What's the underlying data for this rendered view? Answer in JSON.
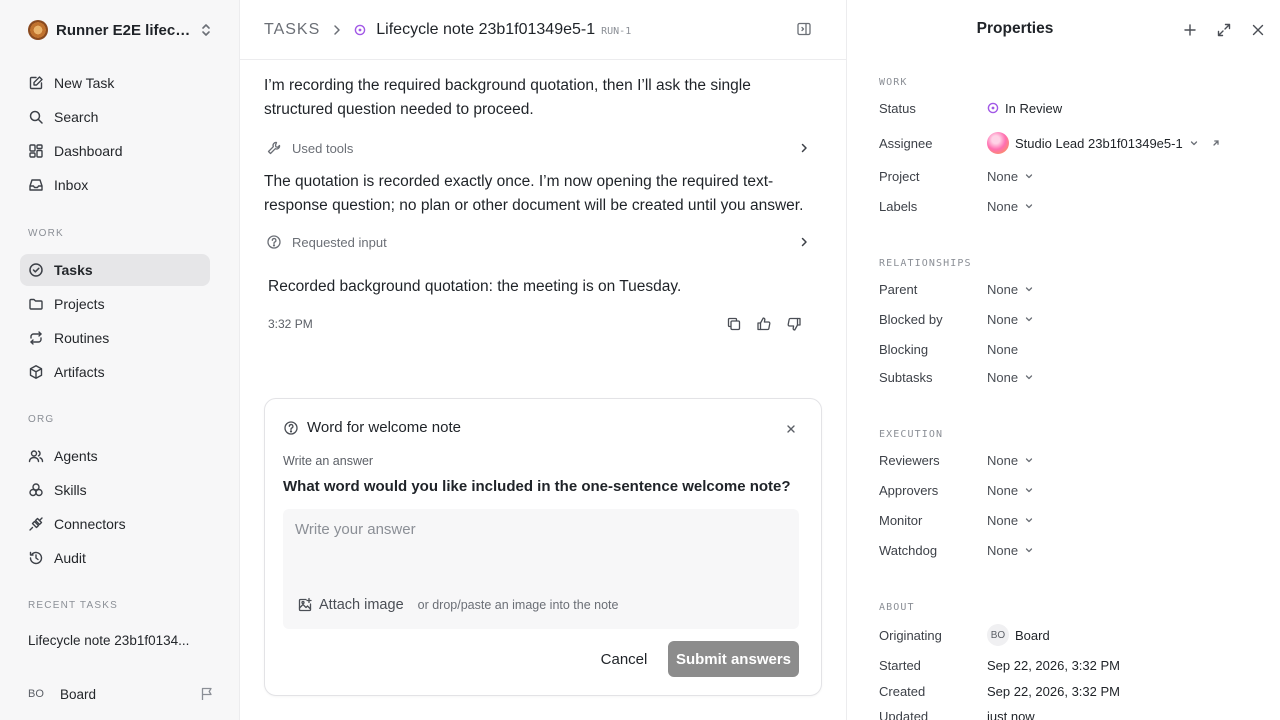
{
  "workspace": {
    "name": "Runner E2E lifecy..."
  },
  "nav": {
    "new_task": "New Task",
    "search": "Search",
    "dashboard": "Dashboard",
    "inbox": "Inbox"
  },
  "sections": {
    "work": "WORK",
    "org": "ORG",
    "recent": "RECENT TASKS"
  },
  "work_nav": {
    "tasks": "Tasks",
    "projects": "Projects",
    "routines": "Routines",
    "artifacts": "Artifacts"
  },
  "org_nav": {
    "agents": "Agents",
    "skills": "Skills",
    "connectors": "Connectors",
    "audit": "Audit"
  },
  "recent_tasks": [
    "Lifecycle note 23b1f0134..."
  ],
  "user": {
    "initials": "BO",
    "name": "Board"
  },
  "header": {
    "root": "TASKS",
    "title": "Lifecycle note 23b1f01349e5-1",
    "run_tag": "RUN-1"
  },
  "messages": {
    "para1": "I’m recording the required background quotation, then I’ll ask the single structured question needed to proceed.",
    "used_tools": "Used tools",
    "para2": "The quotation is recorded exactly once. I’m now opening the required text-response question; no plan or other document will be created until you answer.",
    "requested_input": "Requested input",
    "answer": "Recorded background quotation: the meeting is on Tuesday.",
    "time": "3:32 PM"
  },
  "question_card": {
    "title": "Word for welcome note",
    "label": "Write an answer",
    "question": "What word would you like included in the one-sentence welcome note?",
    "placeholder": "Write your answer",
    "attach_label": "Attach image",
    "attach_hint": "or drop/paste an image into the note",
    "cancel_label": "Cancel",
    "submit_label": "Submit answers"
  },
  "properties": {
    "title": "Properties",
    "sections": {
      "work": "WORK",
      "relationships": "RELATIONSHIPS",
      "execution": "EXECUTION",
      "about": "ABOUT"
    },
    "status": {
      "label": "Status",
      "value": "In Review"
    },
    "assignee": {
      "label": "Assignee",
      "value": "Studio Lead 23b1f01349e5-1"
    },
    "project": {
      "label": "Project",
      "value": "None"
    },
    "labels": {
      "label": "Labels",
      "value": "None"
    },
    "parent": {
      "label": "Parent",
      "value": "None"
    },
    "blocked_by": {
      "label": "Blocked by",
      "value": "None"
    },
    "blocking": {
      "label": "Blocking",
      "value": "None"
    },
    "subtasks": {
      "label": "Subtasks",
      "value": "None"
    },
    "reviewers": {
      "label": "Reviewers",
      "value": "None"
    },
    "approvers": {
      "label": "Approvers",
      "value": "None"
    },
    "monitor": {
      "label": "Monitor",
      "value": "None"
    },
    "watchdog": {
      "label": "Watchdog",
      "value": "None"
    },
    "originating": {
      "label": "Originating",
      "initials": "BO",
      "value": "Board"
    },
    "started": {
      "label": "Started",
      "value": "Sep 22, 2026, 3:32 PM"
    },
    "created": {
      "label": "Created",
      "value": "Sep 22, 2026, 3:32 PM"
    },
    "updated": {
      "label": "Updated",
      "value": "just now"
    }
  },
  "colors": {
    "status_in_review": "#a259e6",
    "submit_disabled": "#8c8c8c"
  }
}
